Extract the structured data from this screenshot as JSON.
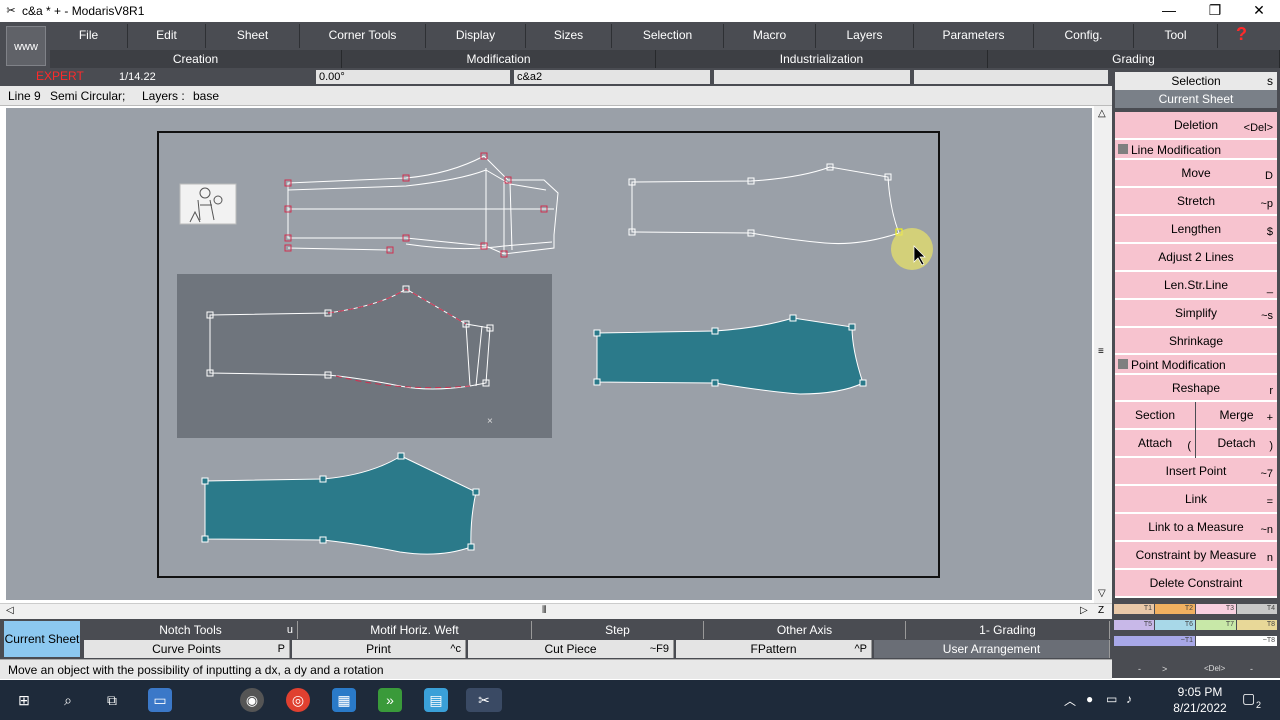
{
  "window": {
    "title": "c&a * + - ModarisV8R1",
    "minimize": "—",
    "maximize": "❐",
    "close": "✕"
  },
  "menubar": {
    "www": "www",
    "items": [
      "File",
      "Edit",
      "Sheet",
      "Corner Tools",
      "Display",
      "Sizes",
      "Selection",
      "Macro",
      "Layers",
      "Parameters",
      "Config.",
      "Tool"
    ],
    "help": "?",
    "sub": [
      "Creation",
      "Modification",
      "Industrialization",
      "Grading"
    ]
  },
  "inforow": {
    "mode": "EXPERT",
    "scale": "1/14.22",
    "angle": "0.00°",
    "name": "c&a2",
    "empty1": "",
    "empty2": ""
  },
  "status": {
    "line": "Line 9",
    "type": "Semi Circular;",
    "layers_label": "Layers :",
    "layers_value": "base"
  },
  "rpanel": {
    "selection": "Selection",
    "selection_key": "s",
    "current_sheet": "Current Sheet",
    "buttons": [
      {
        "label": "Deletion",
        "key": "<Del>"
      },
      {
        "label": "Move",
        "key": "D"
      },
      {
        "label": "Stretch",
        "key": "~p"
      },
      {
        "label": "Lengthen",
        "key": "$"
      },
      {
        "label": "Adjust 2 Lines",
        "key": ""
      },
      {
        "label": "Len.Str.Line",
        "key": "_"
      },
      {
        "label": "Simplify",
        "key": "~s"
      },
      {
        "label": "Shrinkage",
        "key": ""
      },
      {
        "label": "Reshape",
        "key": "r"
      },
      {
        "label": "Section",
        "key": ""
      },
      {
        "label": "Merge",
        "key": "+"
      },
      {
        "label": "Attach",
        "key": "("
      },
      {
        "label": "Detach",
        "key": ")"
      },
      {
        "label": "Insert Point",
        "key": "~7"
      },
      {
        "label": "Link",
        "key": "="
      },
      {
        "label": "Link to a Measure",
        "key": "~n"
      },
      {
        "label": "Constraint by Measure",
        "key": "n"
      },
      {
        "label": "Delete Constraint",
        "key": ""
      }
    ],
    "line_mod": "Line Modification",
    "point_mod": "Point Modification",
    "chips_row1": [
      "T1",
      "T2",
      "T3",
      "T4"
    ],
    "chips_row2": [
      "T5",
      "T6",
      "T7",
      "T8"
    ],
    "chips_row3": [
      "~T1",
      "~T8"
    ],
    "chips_row4": [
      "-",
      ">",
      "<Del>",
      "-"
    ]
  },
  "btool": {
    "current_sheet": "Current Sheet",
    "row1": [
      {
        "label": "Notch Tools",
        "key": "u"
      },
      {
        "label": "Motif Horiz. Weft",
        "key": ""
      },
      {
        "label": "Step",
        "key": ""
      },
      {
        "label": "Other Axis",
        "key": ""
      },
      {
        "label": "1- Grading",
        "key": ""
      }
    ],
    "row2": [
      {
        "label": "Curve Points",
        "key": "P"
      },
      {
        "label": "Print",
        "key": "^c"
      },
      {
        "label": "Cut Piece",
        "key": "~F9"
      },
      {
        "label": "FPattern",
        "key": "^P"
      },
      {
        "label": "User Arrangement",
        "key": ""
      }
    ]
  },
  "help": "Move an object with the possibility of inputting a dx, a dy and a rotation",
  "taskbar": {
    "time": "9:05 PM",
    "date": "8/21/2022",
    "notif": "2"
  },
  "colors": {
    "menubar": "#4a4c52",
    "workarea": "#9aa0a8",
    "pink": "#f7c3cf",
    "teal": "#2b7a8a",
    "selected_piece": "#6f757d"
  }
}
